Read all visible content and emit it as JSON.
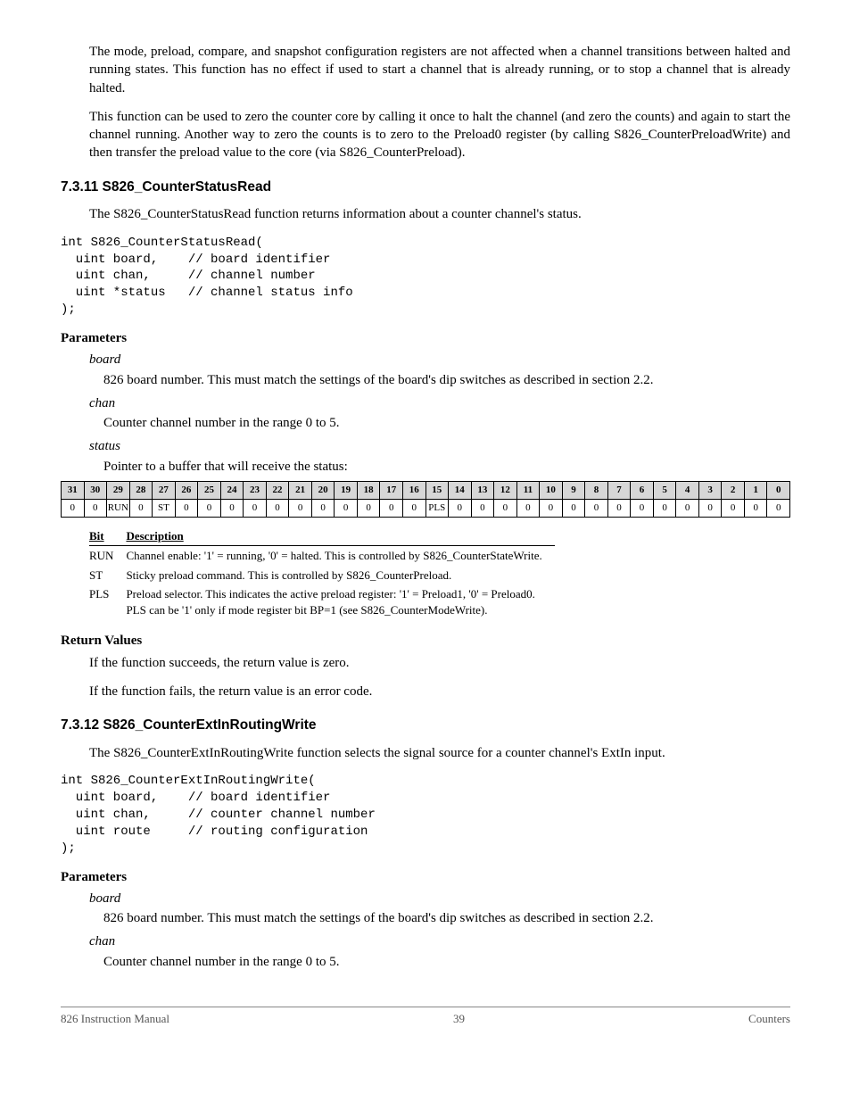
{
  "intro": {
    "p1": "The mode, preload, compare, and snapshot configuration registers are not affected when a channel transitions between halted and running states. This function has no effect if used to start a channel that is already running, or to stop a channel that is already halted.",
    "p2": "This function can be used to zero the counter core by calling it once to halt the channel (and zero the counts) and again to start the channel running. Another way to zero the counts is to zero to the Preload0 register (by calling S826_CounterPreloadWrite) and then transfer the preload value to the core (via S826_CounterPreload)."
  },
  "s7311": {
    "heading": "7.3.11  S826_CounterStatusRead",
    "desc": "The S826_CounterStatusRead function returns information about a counter channel's status.",
    "code": "int S826_CounterStatusRead(\n  uint board,    // board identifier\n  uint chan,     // channel number\n  uint *status   // channel status info\n);",
    "paramsLabel": "Parameters",
    "board": {
      "name": "board",
      "desc": "826 board number. This must match the settings of the board's dip switches as described in section 2.2."
    },
    "chan": {
      "name": "chan",
      "desc": "Counter channel number in the range 0 to 5."
    },
    "status": {
      "name": "status",
      "desc": "Pointer to a buffer that will receive the status:"
    },
    "bitdesc": {
      "headBit": "Bit",
      "headDesc": "Description",
      "run": {
        "bit": "RUN",
        "desc": "Channel enable: '1' = running, '0' = halted. This is controlled by S826_CounterStateWrite."
      },
      "st": {
        "bit": "ST",
        "desc": "Sticky preload command. This is controlled by S826_CounterPreload."
      },
      "pls": {
        "bit": "PLS",
        "desc1": "Preload selector. This indicates the active preload register: '1' = Preload1, '0' = Preload0.",
        "desc2": "PLS can be '1' only if mode register bit BP=1 (see S826_CounterModeWrite)."
      }
    },
    "retLabel": "Return Values",
    "ret1": "If the function succeeds, the return value is zero.",
    "ret2": "If the function fails, the return value is an error code."
  },
  "s7312": {
    "heading": "7.3.12  S826_CounterExtInRoutingWrite",
    "desc": "The S826_CounterExtInRoutingWrite function selects the signal source for a counter channel's ExtIn input.",
    "code": "int S826_CounterExtInRoutingWrite(\n  uint board,    // board identifier\n  uint chan,     // counter channel number\n  uint route     // routing configuration\n);",
    "paramsLabel": "Parameters",
    "board": {
      "name": "board",
      "desc": "826 board number. This must match the settings of the board's dip switches as described in section 2.2."
    },
    "chan": {
      "name": "chan",
      "desc": "Counter channel number in the range 0 to 5."
    }
  },
  "chart_data": {
    "type": "table",
    "title": "status register bit layout",
    "columns": [
      "31",
      "30",
      "29",
      "28",
      "27",
      "26",
      "25",
      "24",
      "23",
      "22",
      "21",
      "20",
      "19",
      "18",
      "17",
      "16",
      "15",
      "14",
      "13",
      "12",
      "11",
      "10",
      "9",
      "8",
      "7",
      "6",
      "5",
      "4",
      "3",
      "2",
      "1",
      "0"
    ],
    "rows": [
      [
        "0",
        "0",
        "RUN",
        "0",
        "ST",
        "0",
        "0",
        "0",
        "0",
        "0",
        "0",
        "0",
        "0",
        "0",
        "0",
        "0",
        "PLS",
        "0",
        "0",
        "0",
        "0",
        "0",
        "0",
        "0",
        "0",
        "0",
        "0",
        "0",
        "0",
        "0",
        "0",
        "0"
      ]
    ]
  },
  "footer": {
    "left": "826 Instruction Manual",
    "center": "39",
    "right": "Counters"
  }
}
